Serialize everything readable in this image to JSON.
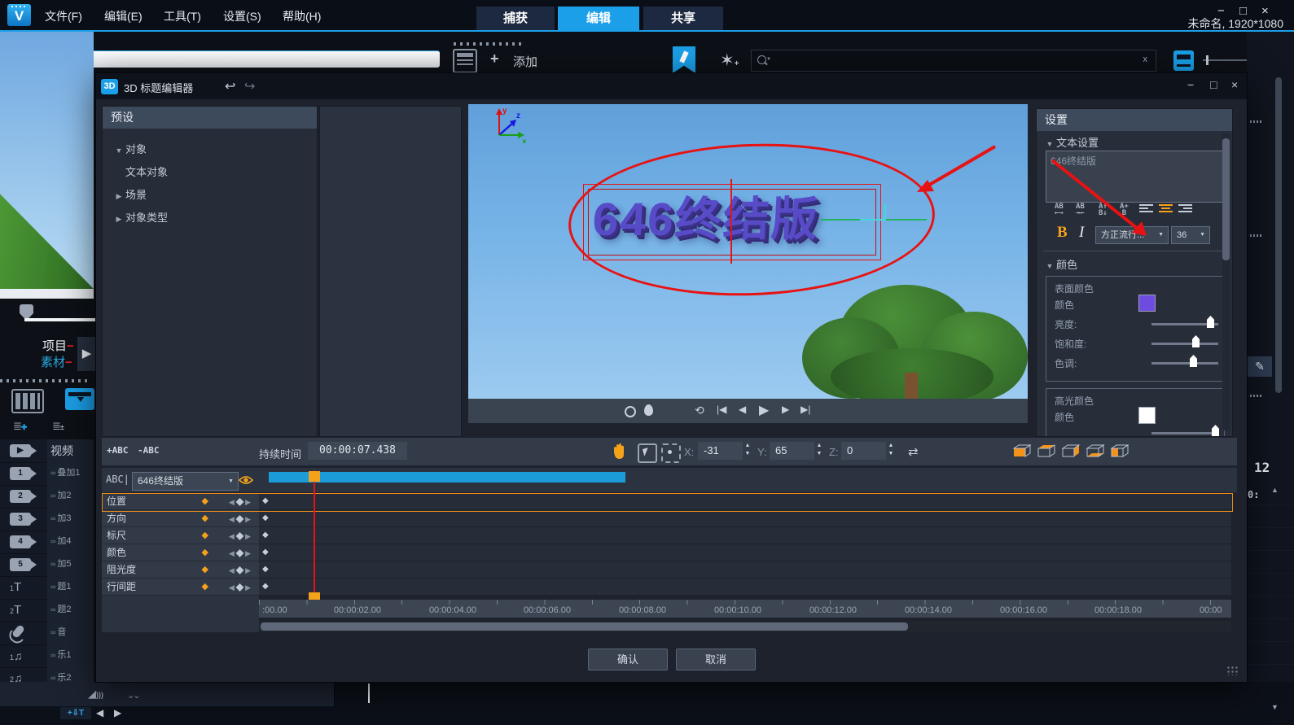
{
  "app": {
    "menu": [
      "文件(F)",
      "编辑(E)",
      "工具(T)",
      "设置(S)",
      "帮助(H)"
    ],
    "tabs": [
      {
        "label": "捕获"
      },
      {
        "label": "编辑"
      },
      {
        "label": "共享"
      }
    ],
    "active_tab": "编辑",
    "window_controls": {
      "minimize": "−",
      "maximize": "□",
      "close": "×"
    },
    "project_label": "未命名, 1920*1080",
    "library": {
      "add_label": "添加",
      "plus": "+",
      "clear": "x"
    },
    "player": {
      "project_label": "项目",
      "material_label": "素材",
      "dash": "−",
      "play": "▶"
    },
    "side_tracks": [
      "视频",
      "叠加1",
      "加2",
      "加3",
      "加4",
      "加5",
      "题1",
      "题2",
      "音",
      "乐1",
      "乐2"
    ],
    "side_track_icons": [
      "video-track",
      "overlay-1",
      "overlay-2",
      "overlay-3",
      "overlay-4",
      "overlay-5",
      "title-1",
      "title-2",
      "voice",
      "music-1",
      "music-2"
    ],
    "bottom": {
      "add_track": "+⇩T",
      "prev": "◀",
      "next": "▶"
    },
    "fragments": {
      "timecode_a": "12",
      "timecode_b": "0:",
      "pencil": "✎",
      "up": "▲",
      "down": "▼"
    }
  },
  "dialog": {
    "badge": "3D",
    "title": "3D 标题编辑器",
    "undo": "↩",
    "redo": "↪",
    "controls": {
      "minimize": "−",
      "maximize": "□",
      "close": "×"
    },
    "presets": {
      "header": "预设",
      "items": [
        {
          "label": "对象",
          "arrow": "▼"
        },
        {
          "label": "文本对象",
          "arrow": ""
        },
        {
          "label": "场景",
          "arrow": "▶"
        },
        {
          "label": "对象类型",
          "arrow": "▶"
        }
      ]
    },
    "preview": {
      "title_text": "646终结版",
      "axis": {
        "x": "x",
        "y": "y",
        "z": "z"
      },
      "title_color": "#584bc8",
      "annotation_color": "#e81212"
    },
    "transport": [
      "⟲",
      "|◀",
      "◀",
      "▶",
      "▶",
      "▶|"
    ],
    "settings": {
      "header": "设置",
      "text_section": "文本设置",
      "text_value": "646终结版",
      "spacing_icons": [
        {
          "t": "AB",
          "b": "←→"
        },
        {
          "t": "AB",
          "b": "→←"
        },
        {
          "t": "A↑",
          "b": "B↓"
        },
        {
          "t": "A+",
          "b": "B"
        }
      ],
      "bold": "B",
      "italic": "I",
      "font_name": "方正流行...",
      "font_size": "36",
      "color_section": "颜色",
      "surface": {
        "title": "表面颜色",
        "color_label": "颜色",
        "swatch": "#6e4ce0",
        "sliders": [
          {
            "label": "亮度:",
            "value_pct": 88
          },
          {
            "label": "饱和度:",
            "value_pct": 66
          },
          {
            "label": "色调:",
            "value_pct": 63
          }
        ]
      },
      "highlight": {
        "title": "高光颜色",
        "color_label": "颜色",
        "swatch": "#ffffff"
      }
    },
    "toolbar": {
      "add_text": "+ABC",
      "remove_text": "-ABC",
      "duration_label": "持续时间",
      "duration_value": "00:00:07.438",
      "x_label": "X:",
      "x_value": "-31",
      "y_label": "Y:",
      "y_value": "65",
      "z_label": "Z:",
      "z_value": "0",
      "swap": "⇄"
    },
    "timeline": {
      "abc_label": "ABC|",
      "object_selector": "646终结版",
      "tracks": [
        "位置",
        "方向",
        "标尺",
        "颜色",
        "阻光度",
        "行间距"
      ],
      "selected_track": "位置",
      "keyframe_diamond": "◆",
      "nav": {
        "prev": "◀",
        "mid": "◆",
        "next": "▶"
      },
      "ruler": [
        ":00.00",
        "00:00:02.00",
        "00:00:04.00",
        "00:00:06.00",
        "00:00:08.00",
        "00:00:10.00",
        "00:00:12.00",
        "00:00:14.00",
        "00:00:16.00",
        "00:00:18.00",
        "00:00"
      ]
    },
    "buttons": {
      "confirm": "确认",
      "cancel": "取消"
    }
  },
  "colors": {
    "accent": "#1b9fe8",
    "orange": "#f5a21b",
    "annotation_red": "#e81212",
    "surface_swatch": "#6e4ce0",
    "highlight_swatch": "#ffffff",
    "timeline_bar": "#1b9cd8"
  }
}
